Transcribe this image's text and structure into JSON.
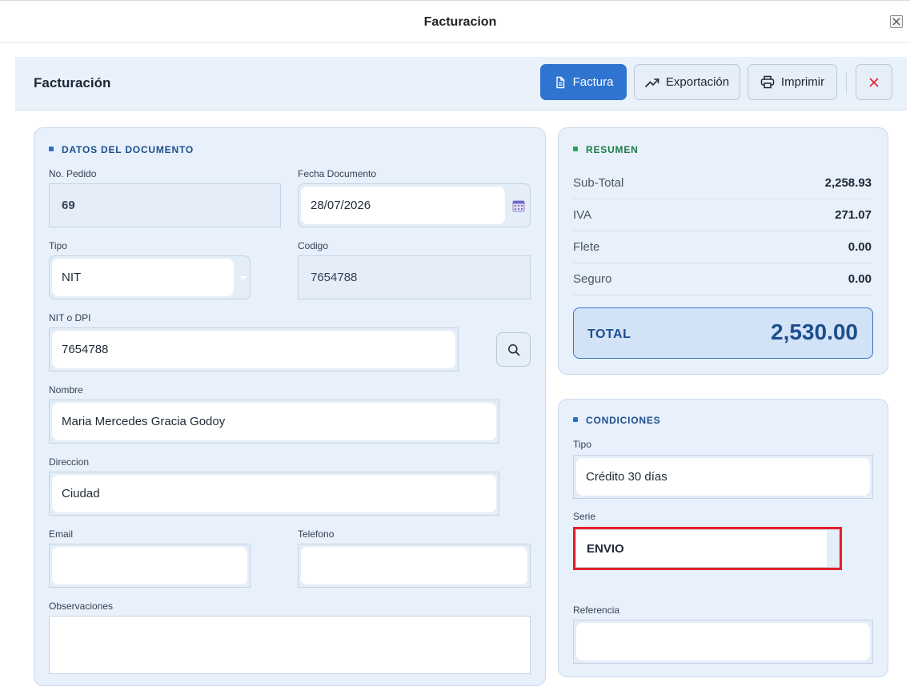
{
  "window": {
    "title": "Facturacion"
  },
  "header": {
    "title": "Facturación",
    "buttons": {
      "factura": "Factura",
      "exportacion": "Exportación",
      "imprimir": "Imprimir"
    }
  },
  "documento": {
    "section_title": "DATOS DEL DOCUMENTO",
    "no_pedido": {
      "label": "No. Pedido",
      "value": "69"
    },
    "fecha": {
      "label": "Fecha Documento",
      "value": "28/07/2026"
    },
    "tipo": {
      "label": "Tipo",
      "value": "NIT"
    },
    "codigo": {
      "label": "Codigo",
      "value": "7654788"
    },
    "nit": {
      "label": "NIT o DPI",
      "value": "7654788"
    },
    "nombre": {
      "label": "Nombre",
      "value": "Maria Mercedes Gracia Godoy"
    },
    "direccion": {
      "label": "Direccion",
      "value": "Ciudad"
    },
    "email": {
      "label": "Email",
      "value": ""
    },
    "telefono": {
      "label": "Telefono",
      "value": ""
    },
    "observaciones": {
      "label": "Observaciones",
      "value": ""
    }
  },
  "resumen": {
    "section_title": "RESUMEN",
    "rows": [
      {
        "label": "Sub-Total",
        "value": "2,258.93"
      },
      {
        "label": "IVA",
        "value": "271.07"
      },
      {
        "label": "Flete",
        "value": "0.00"
      },
      {
        "label": "Seguro",
        "value": "0.00"
      }
    ],
    "total": {
      "label": "TOTAL",
      "value": "2,530.00"
    }
  },
  "condiciones": {
    "section_title": "CONDICIONES",
    "tipo": {
      "label": "Tipo",
      "value": "Crédito 30 días"
    },
    "serie": {
      "label": "Serie",
      "value": "ENVIO"
    },
    "referencia": {
      "label": "Referencia",
      "value": ""
    }
  },
  "colors": {
    "primary": "#2f74d0",
    "accent_blue": "#1e4e8c",
    "accent_green": "#27a35a",
    "highlight": "#e3202b",
    "card_bg": "#e7f0fb"
  },
  "icons": [
    "close-icon",
    "document-icon",
    "trend-up-icon",
    "printer-icon",
    "calendar-icon",
    "chevron-down-icon",
    "search-icon"
  ]
}
